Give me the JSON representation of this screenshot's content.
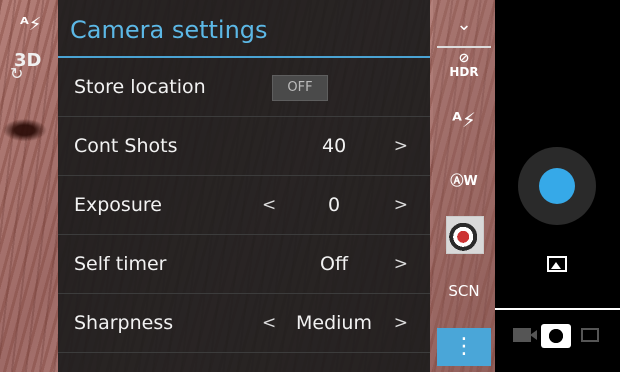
{
  "left_controls": {
    "flash_icon": "flash-auto-icon",
    "three_d_label": "3D"
  },
  "settings": {
    "title": "Camera settings",
    "rows": [
      {
        "label": "Store location",
        "value": "OFF"
      },
      {
        "label": "Cont Shots",
        "value": "40",
        "right_arrow": ">"
      },
      {
        "label": "Exposure",
        "value": "0",
        "left_arrow": "<",
        "right_arrow": ">"
      },
      {
        "label": "Self timer",
        "value": "Off",
        "right_arrow": ">"
      },
      {
        "label": "Sharpness",
        "value": "Medium",
        "left_arrow": "<",
        "right_arrow": ">"
      }
    ]
  },
  "side_strip": {
    "collapse": "⌄",
    "hdr_label": "HDR",
    "flash_label": "ᴬ⚡",
    "white_balance_label": "ⒶW",
    "scene_label": "SCN",
    "more_label": "⋮"
  },
  "colors": {
    "accent": "#4aa6d8",
    "shutter": "#36a9e8",
    "title": "#5cb8e6"
  }
}
